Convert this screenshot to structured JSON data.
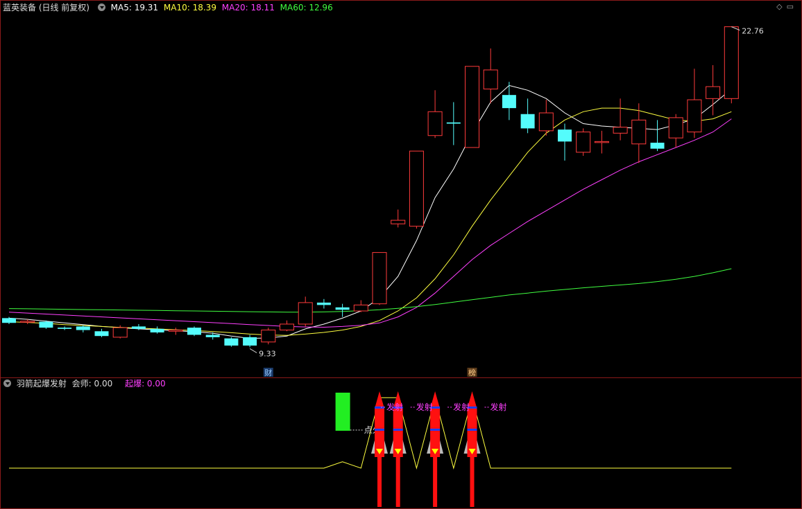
{
  "main_header": {
    "title": "蓝英装备 (日线 前复权)",
    "ma5_label": "MA5: 19.31",
    "ma10_label": "MA10: 18.39",
    "ma20_label": "MA20: 18.11",
    "ma60_label": "MA60: 12.96"
  },
  "sub_header": {
    "title": "羽箭起爆发射",
    "value1_label": "会师: 0.00",
    "value2_label": "起爆: 0.00"
  },
  "colors": {
    "up": "#ff3b3b",
    "down": "#54fcfc",
    "ma5": "#ffffff",
    "ma10": "#ffff40",
    "ma20": "#ff40ff",
    "ma60": "#40ff40",
    "pane_border": "#8b1a1a",
    "green_bar": "#22ee22",
    "rocket": "#ff1010"
  },
  "icons": [
    "settings-diamond-icon",
    "restore-window-icon",
    "collapse-toggle-icon"
  ],
  "chart_data": [
    {
      "type": "candlestick",
      "title": "蓝英装备 (日线 前复权)",
      "price_range": [
        8.5,
        23.3
      ],
      "annotations": {
        "high_label": "22.76",
        "low_label": "9.33",
        "event_markers": [
          "财",
          "榜"
        ]
      },
      "candles": [
        {
          "o": 10.55,
          "c": 10.35,
          "h": 10.6,
          "l": 10.3
        },
        {
          "o": 10.4,
          "c": 10.42,
          "h": 10.5,
          "l": 10.3
        },
        {
          "o": 10.4,
          "c": 10.15,
          "h": 10.45,
          "l": 10.1
        },
        {
          "o": 10.15,
          "c": 10.1,
          "h": 10.2,
          "l": 10.05
        },
        {
          "o": 10.2,
          "c": 10.05,
          "h": 10.25,
          "l": 9.95
        },
        {
          "o": 10.0,
          "c": 9.8,
          "h": 10.1,
          "l": 9.75
        },
        {
          "o": 9.75,
          "c": 10.15,
          "h": 10.25,
          "l": 9.7
        },
        {
          "o": 10.2,
          "c": 10.1,
          "h": 10.3,
          "l": 10.05
        },
        {
          "o": 10.1,
          "c": 9.95,
          "h": 10.2,
          "l": 9.9
        },
        {
          "o": 10.0,
          "c": 10.05,
          "h": 10.15,
          "l": 9.85
        },
        {
          "o": 10.15,
          "c": 9.85,
          "h": 10.2,
          "l": 9.8
        },
        {
          "o": 9.85,
          "c": 9.75,
          "h": 9.95,
          "l": 9.65
        },
        {
          "o": 9.7,
          "c": 9.4,
          "h": 9.75,
          "l": 9.35
        },
        {
          "o": 9.75,
          "c": 9.4,
          "h": 9.85,
          "l": 9.33
        },
        {
          "o": 9.55,
          "c": 10.05,
          "h": 10.15,
          "l": 9.45
        },
        {
          "o": 10.05,
          "c": 10.3,
          "h": 10.45,
          "l": 10.0
        },
        {
          "o": 10.3,
          "c": 11.2,
          "h": 11.45,
          "l": 10.2
        },
        {
          "o": 11.2,
          "c": 11.1,
          "h": 11.35,
          "l": 10.95
        },
        {
          "o": 11.0,
          "c": 10.9,
          "h": 11.15,
          "l": 10.6
        },
        {
          "o": 10.85,
          "c": 11.1,
          "h": 11.3,
          "l": 10.8
        },
        {
          "o": 11.15,
          "c": 13.3,
          "h": 13.3,
          "l": 11.1
        },
        {
          "o": 14.5,
          "c": 14.65,
          "h": 15.1,
          "l": 14.35
        },
        {
          "o": 14.4,
          "c": 17.55,
          "h": 17.55,
          "l": 14.3
        },
        {
          "o": 18.2,
          "c": 19.2,
          "h": 20.1,
          "l": 18.1
        },
        {
          "o": 18.75,
          "c": 18.7,
          "h": 19.6,
          "l": 17.8
        },
        {
          "o": 17.7,
          "c": 21.1,
          "h": 21.1,
          "l": 17.7
        },
        {
          "o": 20.15,
          "c": 20.95,
          "h": 21.85,
          "l": 19.55
        },
        {
          "o": 19.9,
          "c": 19.35,
          "h": 20.45,
          "l": 18.85
        },
        {
          "o": 19.1,
          "c": 18.5,
          "h": 19.75,
          "l": 18.3
        },
        {
          "o": 18.4,
          "c": 19.15,
          "h": 19.7,
          "l": 18.2
        },
        {
          "o": 18.45,
          "c": 17.95,
          "h": 18.7,
          "l": 17.15
        },
        {
          "o": 17.5,
          "c": 18.35,
          "h": 18.5,
          "l": 17.35
        },
        {
          "o": 17.95,
          "c": 17.95,
          "h": 18.4,
          "l": 17.45
        },
        {
          "o": 18.3,
          "c": 18.55,
          "h": 19.75,
          "l": 18.0
        },
        {
          "o": 17.85,
          "c": 18.85,
          "h": 19.55,
          "l": 17.05
        },
        {
          "o": 17.9,
          "c": 17.65,
          "h": 18.85,
          "l": 17.55
        },
        {
          "o": 18.1,
          "c": 18.95,
          "h": 19.1,
          "l": 17.7
        },
        {
          "o": 18.35,
          "c": 19.7,
          "h": 21.0,
          "l": 18.1
        },
        {
          "o": 19.75,
          "c": 20.25,
          "h": 21.15,
          "l": 19.05
        },
        {
          "o": 19.75,
          "c": 22.76,
          "h": 22.76,
          "l": 19.55
        }
      ],
      "series": [
        {
          "name": "MA5",
          "values": [
            10.55,
            10.5,
            10.42,
            10.35,
            10.28,
            10.2,
            10.15,
            10.1,
            10.06,
            10.02,
            9.98,
            9.92,
            9.8,
            9.7,
            9.72,
            9.8,
            10.1,
            10.3,
            10.55,
            10.85,
            11.4,
            12.3,
            13.8,
            15.6,
            16.8,
            18.3,
            19.6,
            20.3,
            20.1,
            19.75,
            19.15,
            18.7,
            18.6,
            18.55,
            18.5,
            18.45,
            18.65,
            18.9,
            19.5,
            20.15
          ]
        },
        {
          "name": "MA10",
          "values": [
            10.4,
            10.37,
            10.33,
            10.28,
            10.24,
            10.2,
            10.16,
            10.13,
            10.1,
            10.06,
            10.03,
            9.99,
            9.94,
            9.88,
            9.84,
            9.83,
            9.88,
            9.95,
            10.05,
            10.2,
            10.45,
            10.85,
            11.4,
            12.2,
            13.2,
            14.4,
            15.5,
            16.5,
            17.5,
            18.3,
            18.85,
            19.2,
            19.35,
            19.35,
            19.25,
            19.05,
            18.85,
            18.8,
            18.9,
            19.2
          ]
        },
        {
          "name": "MA20",
          "values": [
            10.8,
            10.76,
            10.72,
            10.68,
            10.64,
            10.6,
            10.56,
            10.52,
            10.48,
            10.44,
            10.4,
            10.36,
            10.32,
            10.28,
            10.24,
            10.2,
            10.18,
            10.17,
            10.2,
            10.25,
            10.35,
            10.6,
            11.0,
            11.6,
            12.3,
            13.0,
            13.6,
            14.1,
            14.6,
            15.05,
            15.5,
            15.95,
            16.35,
            16.75,
            17.1,
            17.4,
            17.7,
            18.0,
            18.35,
            18.9
          ]
        },
        {
          "name": "MA60",
          "values": [
            10.95,
            10.94,
            10.93,
            10.92,
            10.91,
            10.9,
            10.89,
            10.88,
            10.87,
            10.86,
            10.85,
            10.84,
            10.83,
            10.82,
            10.81,
            10.8,
            10.8,
            10.81,
            10.83,
            10.86,
            10.9,
            10.96,
            11.03,
            11.12,
            11.22,
            11.32,
            11.42,
            11.52,
            11.6,
            11.68,
            11.75,
            11.82,
            11.88,
            11.94,
            12.0,
            12.08,
            12.18,
            12.3,
            12.45,
            12.62
          ]
        }
      ]
    },
    {
      "type": "indicator",
      "title": "羽箭起爆发射",
      "labels": {
        "dianhuo": "点火",
        "fashe": "发射"
      },
      "green_bar_index": 18,
      "rocket_indices": [
        20,
        21,
        23,
        25
      ],
      "fashe_label_count": 4,
      "line_values": [
        0,
        0,
        0,
        0,
        0,
        0,
        0,
        0,
        0,
        0,
        0,
        0,
        0,
        0,
        0,
        0,
        0,
        0,
        0.05,
        0,
        0.55,
        0.55,
        0,
        0.55,
        0,
        0.55,
        0,
        0,
        0,
        0,
        0,
        0,
        0,
        0,
        0,
        0,
        0,
        0,
        0,
        0
      ],
      "line_range": [
        0,
        0.6
      ]
    }
  ]
}
